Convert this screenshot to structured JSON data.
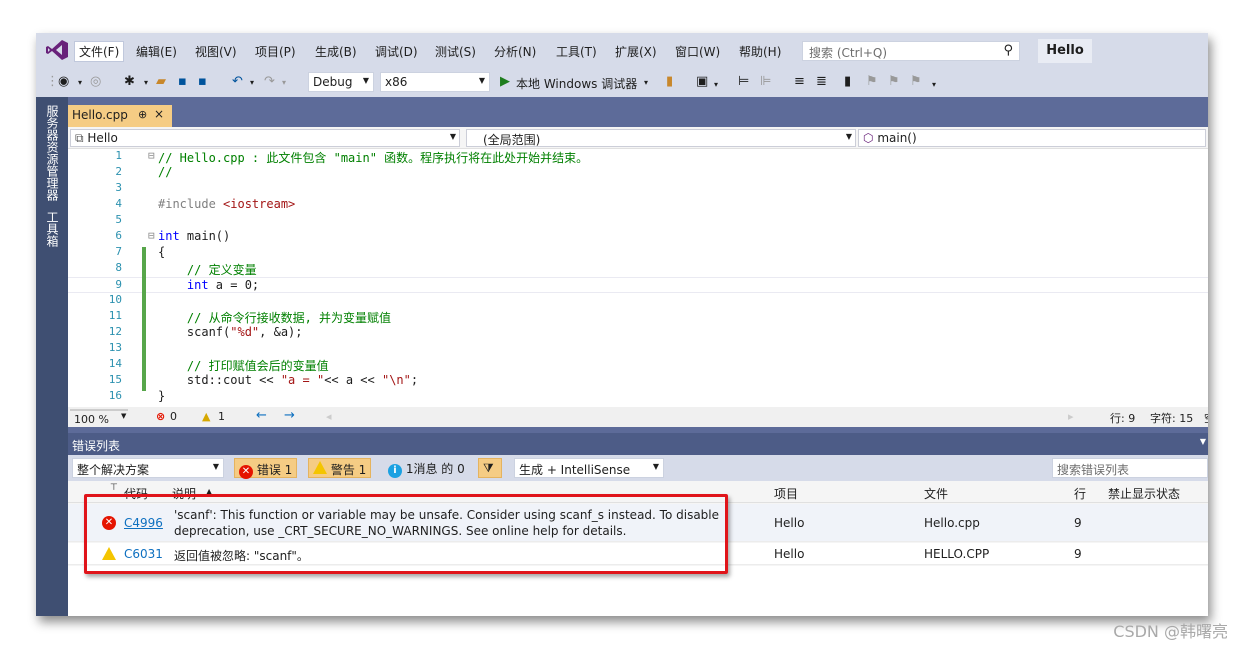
{
  "menubar": {
    "items": [
      "文件(F)",
      "编辑(E)",
      "视图(V)",
      "项目(P)",
      "生成(B)",
      "调试(D)",
      "测试(S)",
      "分析(N)",
      "工具(T)",
      "扩展(X)",
      "窗口(W)",
      "帮助(H)"
    ],
    "search_placeholder": "搜索 (Ctrl+Q)",
    "solution_name": "Hello"
  },
  "toolbar": {
    "config": "Debug",
    "platform": "x86",
    "run_label": "本地 Windows 调试器"
  },
  "left_strip": {
    "tabs": [
      "服务器资源管理器",
      "工具箱"
    ]
  },
  "doc_tab": {
    "label": "Hello.cpp",
    "pin": "⊕",
    "close": "×"
  },
  "nav": {
    "project": "Hello",
    "scope": "(全局范围)",
    "member": "main()"
  },
  "code": {
    "lines": [
      {
        "n": "1",
        "fold": "⊟",
        "segs": [
          {
            "c": "cm",
            "t": "// Hello.cpp : 此文件包含 \"main\" 函数。程序执行将在此处开始并结束。"
          }
        ]
      },
      {
        "n": "2",
        "fold": "",
        "segs": [
          {
            "c": "cm",
            "t": "//"
          }
        ]
      },
      {
        "n": "3",
        "fold": "",
        "segs": []
      },
      {
        "n": "4",
        "fold": "",
        "segs": [
          {
            "c": "pp",
            "t": "#include "
          },
          {
            "c": "str",
            "t": "<iostream>"
          }
        ]
      },
      {
        "n": "5",
        "fold": "",
        "segs": []
      },
      {
        "n": "6",
        "fold": "⊟",
        "segs": [
          {
            "c": "kw",
            "t": "int"
          },
          {
            "c": "",
            "t": " main()"
          }
        ]
      },
      {
        "n": "7",
        "fold": "",
        "segs": [
          {
            "c": "",
            "t": "{"
          }
        ]
      },
      {
        "n": "8",
        "fold": "",
        "segs": [
          {
            "c": "cm",
            "t": "    // 定义变量"
          }
        ]
      },
      {
        "n": "9",
        "fold": "",
        "segs": [
          {
            "c": "kw",
            "t": "    int"
          },
          {
            "c": "",
            "t": " a = 0;"
          }
        ]
      },
      {
        "n": "10",
        "fold": "",
        "segs": []
      },
      {
        "n": "11",
        "fold": "",
        "segs": [
          {
            "c": "cm",
            "t": "    // 从命令行接收数据, 并为变量赋值"
          }
        ]
      },
      {
        "n": "12",
        "fold": "",
        "segs": [
          {
            "c": "",
            "t": "    scanf("
          },
          {
            "c": "str",
            "t": "\"%d\""
          },
          {
            "c": "",
            "t": ", &a);"
          }
        ]
      },
      {
        "n": "13",
        "fold": "",
        "segs": []
      },
      {
        "n": "14",
        "fold": "",
        "segs": [
          {
            "c": "cm",
            "t": "    // 打印赋值会后的变量值"
          }
        ]
      },
      {
        "n": "15",
        "fold": "",
        "segs": [
          {
            "c": "",
            "t": "    std::cout << "
          },
          {
            "c": "str",
            "t": "\"a = \""
          },
          {
            "c": "",
            "t": "<< a << "
          },
          {
            "c": "str",
            "t": "\"\\n\""
          },
          {
            "c": "",
            "t": ";"
          }
        ]
      },
      {
        "n": "16",
        "fold": "",
        "segs": [
          {
            "c": "",
            "t": "}"
          }
        ]
      }
    ]
  },
  "editor_status": {
    "zoom": "100 %",
    "errors": "0",
    "warnings": "1",
    "line": "行: 9",
    "char": "字符: 15",
    "mode": "空格"
  },
  "error_list": {
    "title": "错误列表",
    "scope": "整个解决方案",
    "errors_btn": "错误 1",
    "warnings_btn": "警告 1",
    "messages_btn": "1消息 的 0",
    "build_filter": "生成 + IntelliSense",
    "search_placeholder": "搜索错误列表",
    "columns": {
      "code": "代码",
      "desc": "说明",
      "project": "项目",
      "file": "文件",
      "line": "行",
      "suppress": "禁止显示状态"
    },
    "rows": [
      {
        "severity": "error",
        "code": "C4996",
        "desc1": "'scanf': This function or variable may be unsafe. Consider using scanf_s instead. To disable",
        "desc2": "deprecation, use _CRT_SECURE_NO_WARNINGS. See online help for details.",
        "project": "Hello",
        "file": "Hello.cpp",
        "line": "9"
      },
      {
        "severity": "warning",
        "code": "C6031",
        "desc1": "返回值被忽略: \"scanf\"。",
        "desc2": "",
        "project": "Hello",
        "file": "HELLO.CPP",
        "line": "9"
      }
    ]
  },
  "watermark": "CSDN @韩曙亮"
}
